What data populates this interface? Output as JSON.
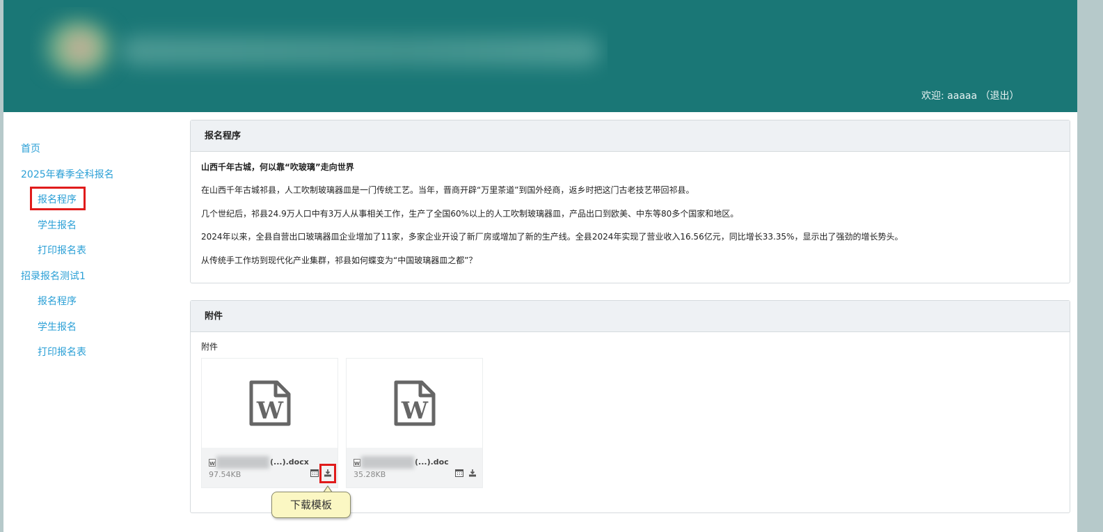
{
  "header": {
    "welcome_label": "欢迎: ",
    "username": "aaaaa",
    "logout_label": "（退出）"
  },
  "sidebar": {
    "items": [
      {
        "label": "首页"
      },
      {
        "label": "2025年春季全科报名"
      },
      {
        "label": "报名程序"
      },
      {
        "label": "学生报名"
      },
      {
        "label": "打印报名表"
      },
      {
        "label": "招录报名测试1"
      },
      {
        "label": "报名程序"
      },
      {
        "label": "学生报名"
      },
      {
        "label": "打印报名表"
      }
    ]
  },
  "procedure_panel": {
    "title": "报名程序",
    "article_title": "山西千年古城，何以靠“吹玻璃”走向世界",
    "paragraphs": [
      "在山西千年古城祁县，人工吹制玻璃器皿是一门传统工艺。当年，晋商开辟“万里茶道”到国外经商，返乡时把这门古老技艺带回祁县。",
      "几个世纪后，祁县24.9万人口中有3万人从事相关工作，生产了全国60%以上的人工吹制玻璃器皿，产品出口到欧美、中东等80多个国家和地区。",
      "2024年以来，全县自营出口玻璃器皿企业增加了11家，多家企业开设了新厂房或增加了新的生产线。全县2024年实现了营业收入16.56亿元，同比增长33.35%，显示出了强劲的增长势头。",
      "从传统手工作坊到现代化产业集群，祁县如何蝶变为“中国玻璃器皿之都”？"
    ]
  },
  "attachments_panel": {
    "title": "附件",
    "section_label": "附件",
    "files": [
      {
        "name_suffix": "(...).docx",
        "size": "97.54KB",
        "preview_glyph": "W"
      },
      {
        "name_suffix": "(...).doc",
        "size": "35.28KB",
        "preview_glyph": "W"
      }
    ]
  },
  "tooltip": {
    "text": "下载模板"
  },
  "colors": {
    "header_bg": "#1a7776",
    "link": "#2a9fd6",
    "highlight": "#e01b1b"
  }
}
